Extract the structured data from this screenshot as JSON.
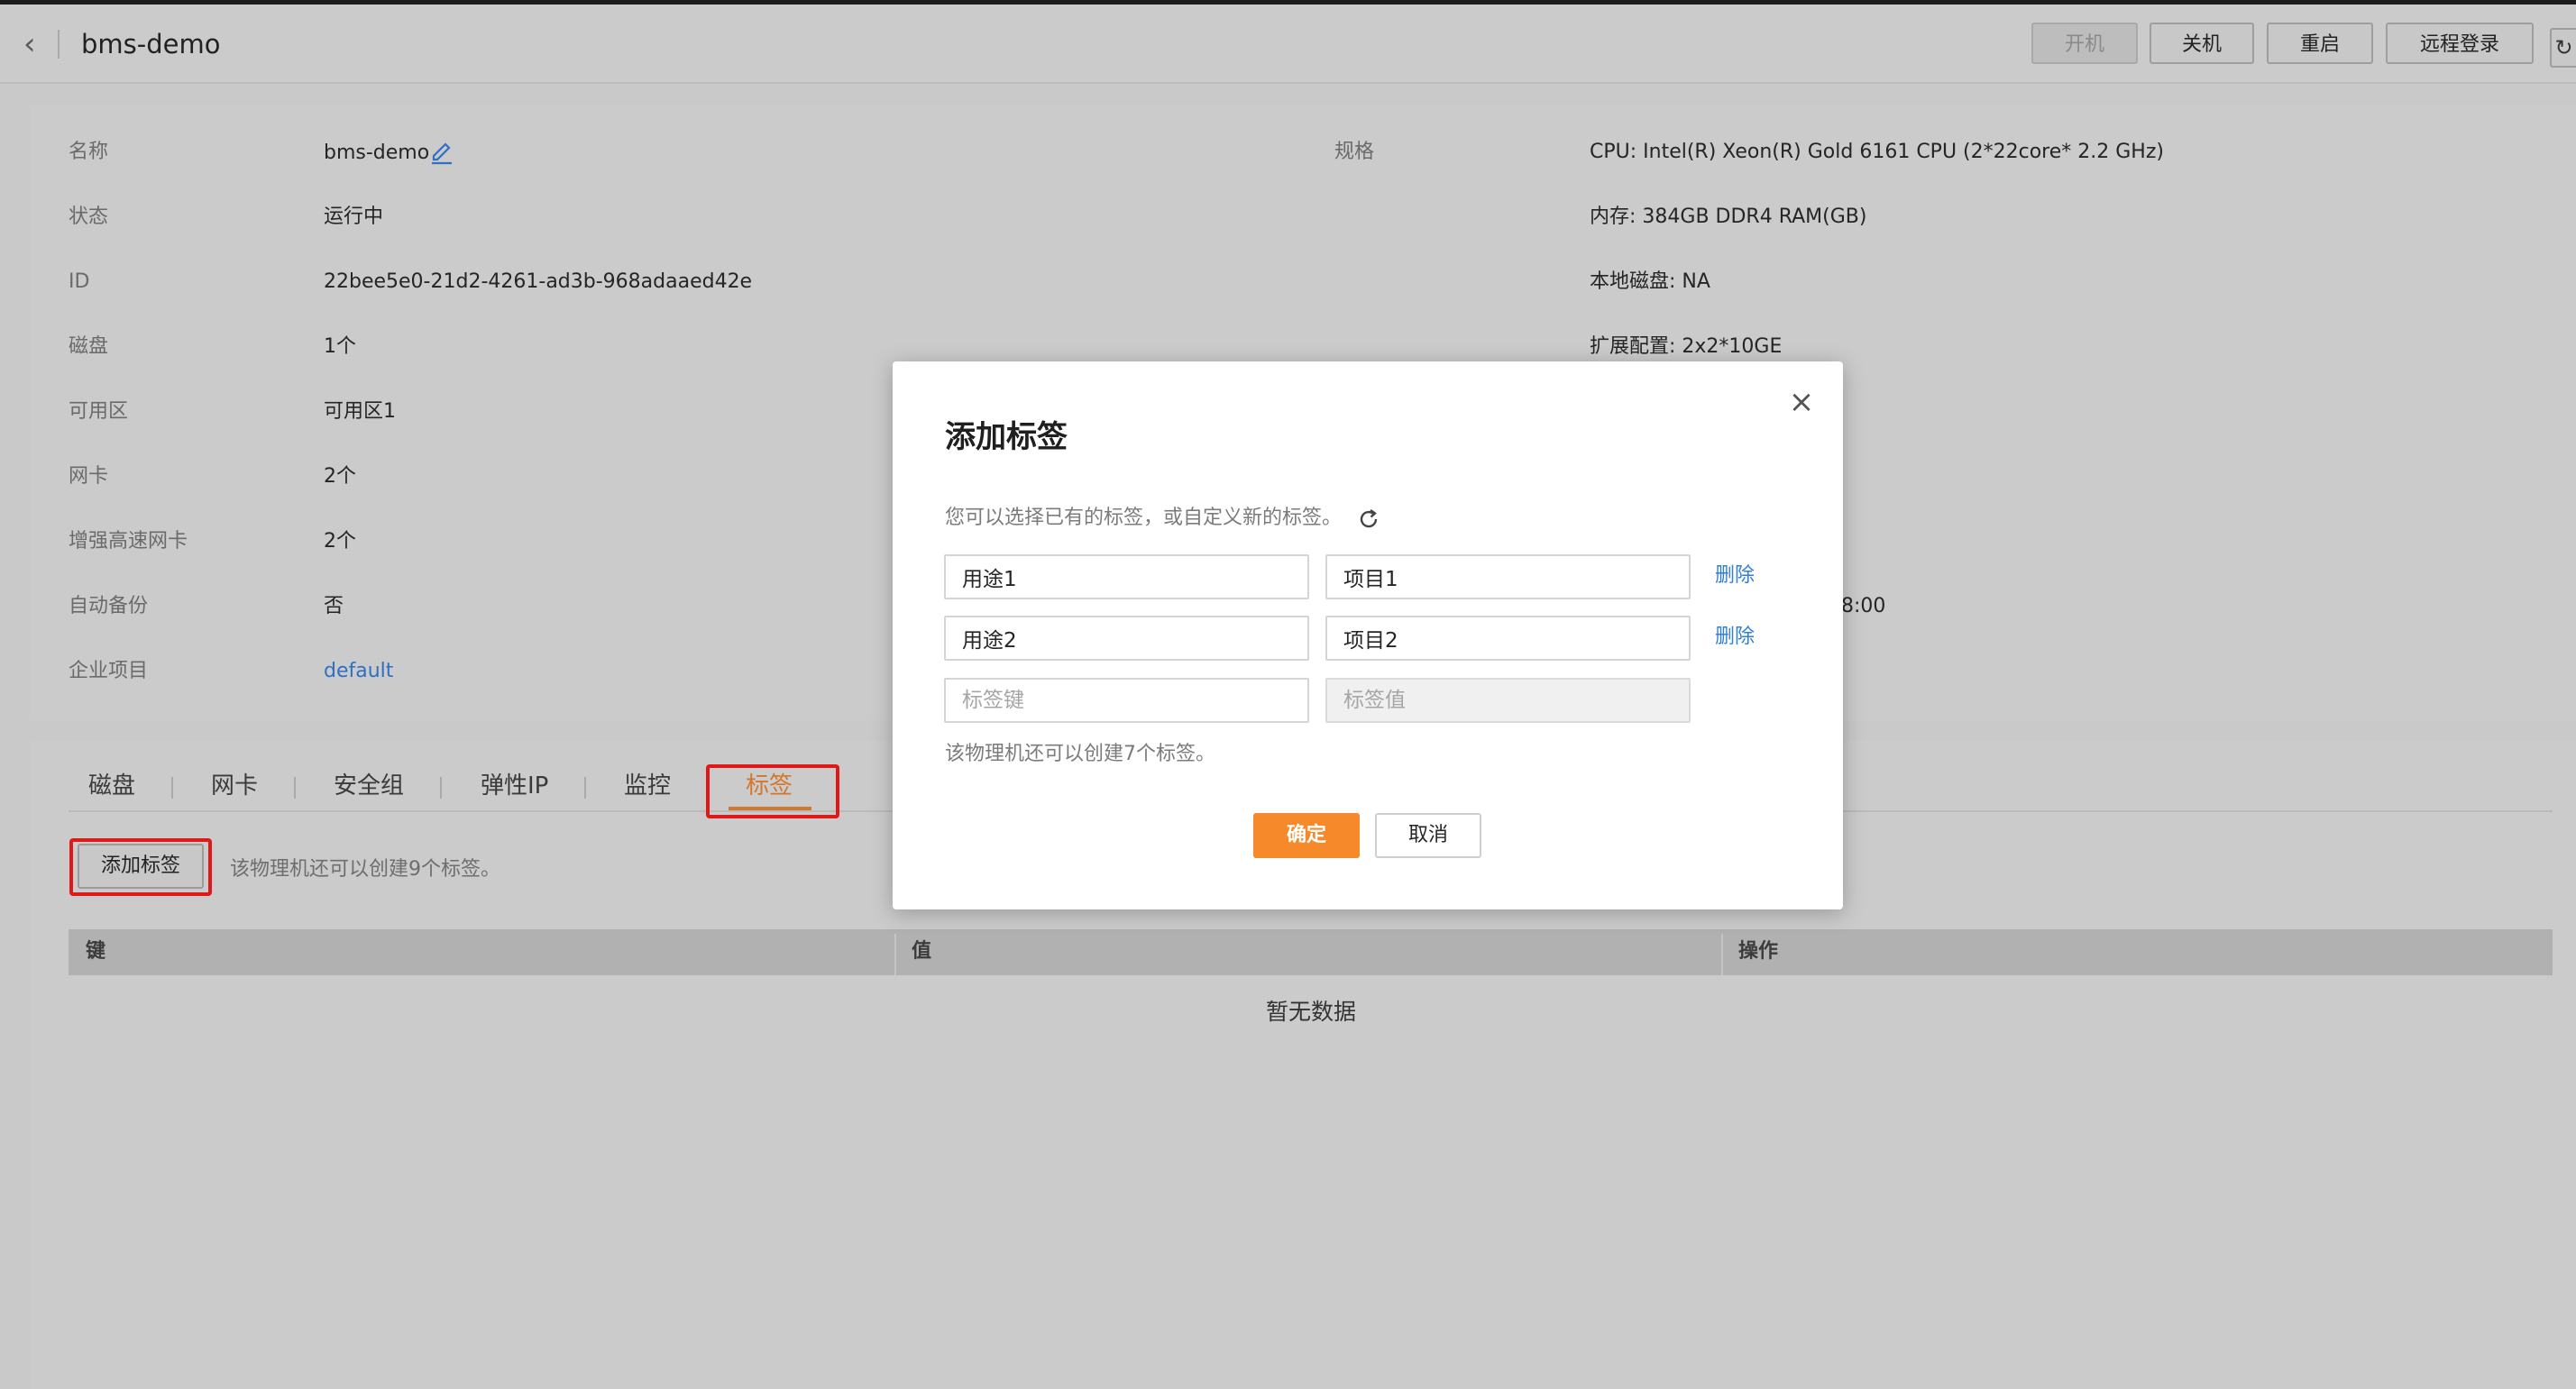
{
  "header": {
    "title": "bms-demo",
    "buttons": {
      "start": "开机",
      "shutdown": "关机",
      "restart": "重启",
      "remote_login": "远程登录"
    }
  },
  "info_left": [
    {
      "label": "名称",
      "value": "bms-demo"
    },
    {
      "label": "状态",
      "value": "运行中"
    },
    {
      "label": "ID",
      "value": "22bee5e0-21d2-4261-ad3b-968adaaed42e"
    },
    {
      "label": "磁盘",
      "value": "1个"
    },
    {
      "label": "可用区",
      "value": "可用区1"
    },
    {
      "label": "网卡",
      "value": "2个"
    },
    {
      "label": "增强高速网卡",
      "value": "2个"
    },
    {
      "label": "自动备份",
      "value": "否"
    },
    {
      "label": "企业项目",
      "value": "default"
    }
  ],
  "info_right": {
    "label": "规格",
    "cpu": "CPU: Intel(R) Xeon(R) Gold 6161 CPU (2*22core* 2.2 GHz)",
    "memory": "内存: 384GB DDR4 RAM(GB)",
    "local_disk": "本地磁盘: NA",
    "extension": "扩展配置: 2x2*10GE",
    "partial_time": "8:00"
  },
  "tabs": [
    "磁盘",
    "网卡",
    "安全组",
    "弹性IP",
    "监控",
    "标签"
  ],
  "tags_panel": {
    "add_button": "添加标签",
    "hint": "该物理机还可以创建9个标签。",
    "columns": [
      "键",
      "值",
      "操作"
    ],
    "empty": "暂无数据"
  },
  "dialog": {
    "title": "添加标签",
    "intro": "您可以选择已有的标签，或自定义新的标签。",
    "rows": [
      {
        "key": "用途1",
        "value": "项目1",
        "action": "删除"
      },
      {
        "key": "用途2",
        "value": "项目2",
        "action": "删除"
      }
    ],
    "key_placeholder": "标签键",
    "value_placeholder": "标签值",
    "hint": "该物理机还可以创建7个标签。",
    "ok": "确定",
    "cancel": "取消"
  },
  "colors": {
    "accent": "#f6892a",
    "link": "#2f7fd6",
    "highlight": "#e01818"
  }
}
